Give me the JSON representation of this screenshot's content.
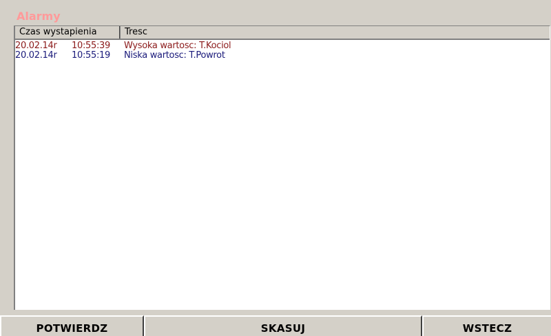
{
  "window": {
    "title": "Alarmy"
  },
  "table": {
    "columns": [
      {
        "label": "Czas wystapienia"
      },
      {
        "label": "Tresc"
      }
    ],
    "rows": [
      {
        "date": "20.02.14r",
        "time": "10:55:39",
        "message": "Wysoka wartosc: T.Kociol",
        "color": "#8b1a1a"
      },
      {
        "date": "20.02.14r",
        "time": "10:55:19",
        "message": "Niska wartosc: T.Powrot",
        "color": "#1a1a7a"
      }
    ]
  },
  "footer": {
    "confirm_label": "POTWIERDZ",
    "clear_label": "SKASUJ",
    "back_label": "WSTECZ"
  },
  "colors": {
    "title": "#ff9a9a",
    "background": "#d4d0c8",
    "high_alarm": "#8b1a1a",
    "low_alarm": "#1a1a7a"
  }
}
